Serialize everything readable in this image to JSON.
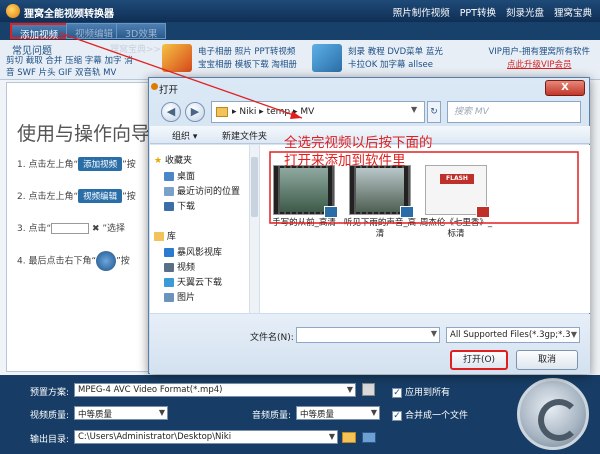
{
  "app": {
    "title": "狸窝全能视频转换器",
    "menu": [
      "照片制作视频",
      "PPT转换",
      "刻录光盘",
      "狸窝宝典"
    ],
    "tabs": [
      "添加视频",
      "视频编辑",
      "3D效果"
    ]
  },
  "adbar": {
    "help_title": "常见问题",
    "help_sub": "狸窝宝典>>",
    "help_links": "剪切 截取 合并 压缩 字幕 加字 消音 SWF 片头 GIF 双音轨 MV",
    "ad1_lines": [
      "电子相册 照片 PPT转视频",
      "宝宝相册 模板下载 淘相册"
    ],
    "ad2_lines": [
      "刻录 教程 DVD菜单 蓝光",
      "卡拉OK 加字幕 allsee"
    ],
    "vip_line": "VIP用户-拥有狸窝所有软件",
    "vip_link": "点此升级VIP会员"
  },
  "guide": {
    "title": "使用与操作向导",
    "step1_prefix": "1. 点击左上角“",
    "step1_btn": "添加视频",
    "step1_suffix": "”按",
    "step2_prefix": "2. 点击左上角“",
    "step2_btn": "视频编辑",
    "step2_suffix": "”按",
    "step3_prefix": "3. 点击“",
    "step3_suffix": "”选择",
    "step4_prefix": "4. 最后点击右下角“",
    "step4_suffix": "”按"
  },
  "bottom": {
    "preset_label": "预置方案:",
    "preset_value": "MPEG-4 AVC Video Format(*.mp4)",
    "apply_all": "应用到所有",
    "video_quality_label": "视频质量:",
    "video_quality_value": "中等质量",
    "audio_quality_label": "音频质量:",
    "audio_quality_value": "中等质量",
    "merge_label": "合并成一个文件",
    "output_label": "输出目录:",
    "output_value": "C:\\Users\\Administrator\\Desktop\\Niki"
  },
  "dialog": {
    "title": "打开",
    "close": "X",
    "path": "▸ Niki ▸ temp ▸ MV",
    "search_placeholder": "搜索 MV",
    "organize": "组织 ▾",
    "new_folder": "新建文件夹",
    "tree_favorites": "收藏夹",
    "tree_items": [
      "桌面",
      "最近访问的位置",
      "下载"
    ],
    "tree_libraries": "库",
    "tree_lib_items": [
      "暴风影视库",
      "视频",
      "天翼云下载",
      "图片"
    ],
    "files": [
      {
        "name": "手写的从前_高清"
      },
      {
        "name": "听见下雨的声音_高清"
      },
      {
        "name": "周杰伦《七里香》_标清"
      }
    ],
    "annotation": "全选完视频以后按下面的\n打开来添加到软件里",
    "filename_label": "文件名(N):",
    "filetype_value": "All Supported Files(*.3gp;*.3",
    "open_button": "打开(O)",
    "cancel_button": "取消"
  },
  "colors": {
    "accent_red": "#e02020",
    "title_blue": "#1c4f86"
  }
}
